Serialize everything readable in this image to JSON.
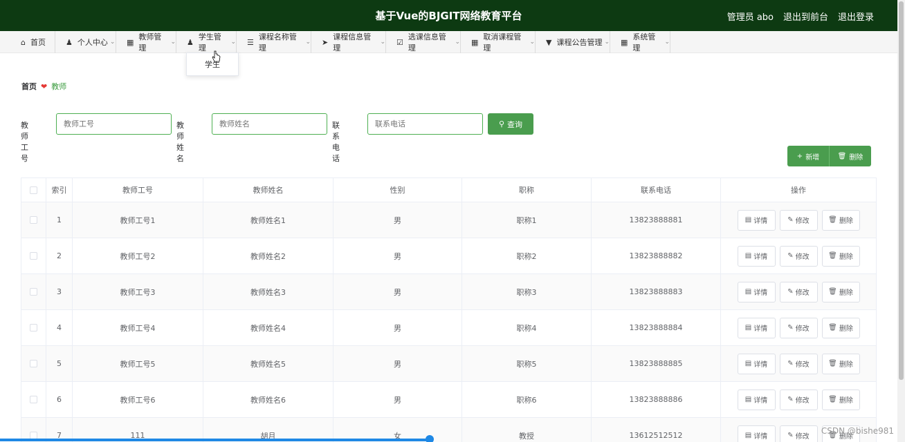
{
  "header": {
    "title": "基于Vue的BJGIT网络教育平台",
    "admin": "管理员 abo",
    "front_link": "退出到前台",
    "logout_link": "退出登录"
  },
  "nav": [
    {
      "label": "首页",
      "icon": "home-icon"
    },
    {
      "label": "个人中心",
      "icon": "user-icon"
    },
    {
      "label": "教师管理",
      "icon": "grid-icon"
    },
    {
      "label": "学生管理",
      "icon": "user-icon"
    },
    {
      "label": "课程名称管理",
      "icon": "book-icon"
    },
    {
      "label": "课程信息管理",
      "icon": "send-icon"
    },
    {
      "label": "选课信息管理",
      "icon": "check-icon"
    },
    {
      "label": "取消课程管理",
      "icon": "grid-icon"
    },
    {
      "label": "课程公告管理",
      "icon": "notice-icon"
    },
    {
      "label": "系统管理",
      "icon": "grid-icon"
    }
  ],
  "dropdown": {
    "item": "学生"
  },
  "breadcrumb": {
    "home": "首页",
    "current": "教师"
  },
  "search": {
    "id_label": "教师工号",
    "id_placeholder": "教师工号",
    "name_label": "教师姓名",
    "name_placeholder": "教师姓名",
    "phone_label": "联系电话",
    "phone_placeholder": "联系电话",
    "query_button": "查询"
  },
  "actions": {
    "add": "新增",
    "delete": "删除"
  },
  "table": {
    "headers": [
      "索引",
      "教师工号",
      "教师姓名",
      "性别",
      "职称",
      "联系电话",
      "操作"
    ],
    "row_actions": {
      "detail": "详情",
      "edit": "修改",
      "delete": "删除"
    },
    "rows": [
      {
        "index": "1",
        "id": "教师工号1",
        "name": "教师姓名1",
        "gender": "男",
        "title": "职称1",
        "phone": "13823888881"
      },
      {
        "index": "2",
        "id": "教师工号2",
        "name": "教师姓名2",
        "gender": "男",
        "title": "职称2",
        "phone": "13823888882"
      },
      {
        "index": "3",
        "id": "教师工号3",
        "name": "教师姓名3",
        "gender": "男",
        "title": "职称3",
        "phone": "13823888883"
      },
      {
        "index": "4",
        "id": "教师工号4",
        "name": "教师姓名4",
        "gender": "男",
        "title": "职称4",
        "phone": "13823888884"
      },
      {
        "index": "5",
        "id": "教师工号5",
        "name": "教师姓名5",
        "gender": "男",
        "title": "职称5",
        "phone": "13823888885"
      },
      {
        "index": "6",
        "id": "教师工号6",
        "name": "教师姓名6",
        "gender": "男",
        "title": "职称6",
        "phone": "13823888886"
      },
      {
        "index": "7",
        "id": "111",
        "name": "胡月",
        "gender": "女",
        "title": "教授",
        "phone": "13612512512"
      }
    ]
  },
  "watermark": "CSDN @bishe981"
}
